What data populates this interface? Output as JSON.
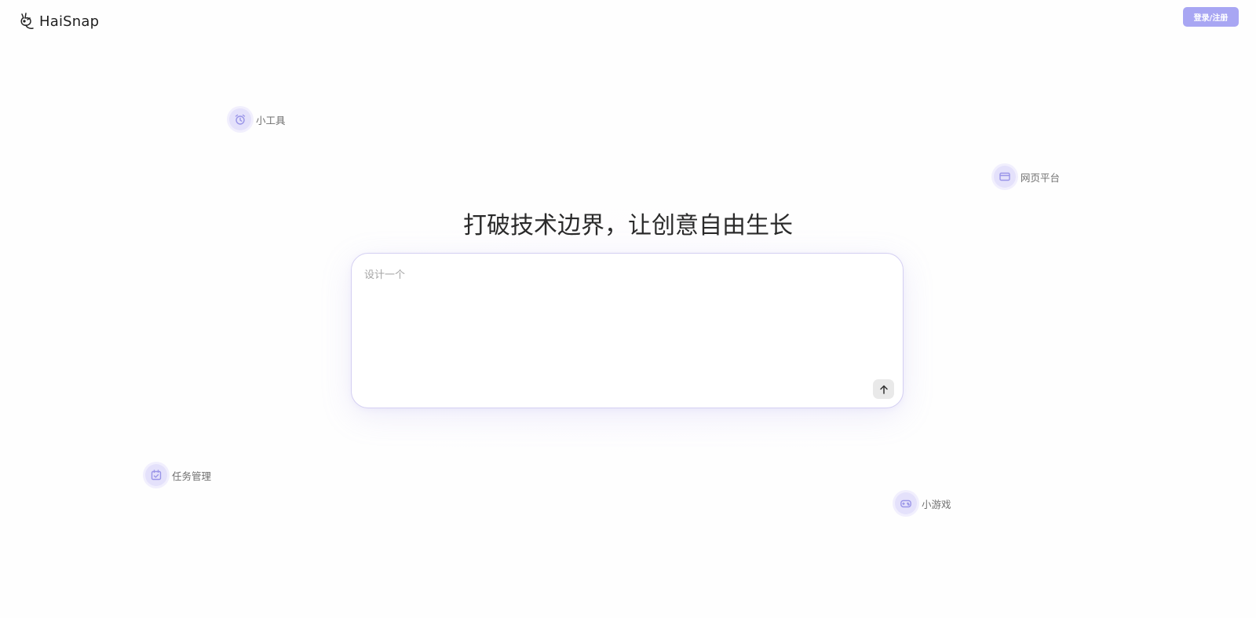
{
  "header": {
    "brand": "HaiSnap",
    "login_label": "登录/注册"
  },
  "hero": {
    "headline": "打破技术边界，让创意自由生长",
    "prompt_placeholder": "设计一个",
    "prompt_value": ""
  },
  "categories": [
    {
      "label": "小工具",
      "icon": "alarm-clock-icon"
    },
    {
      "label": "网页平台",
      "icon": "browser-window-icon"
    },
    {
      "label": "任务管理",
      "icon": "calendar-check-icon"
    },
    {
      "label": "小游戏",
      "icon": "gamepad-icon"
    }
  ],
  "colors": {
    "accent": "#a8a6f3",
    "chip_bg": "#e4e1fb",
    "chip_icon": "#9a95e8",
    "border": "#d4cff2"
  }
}
